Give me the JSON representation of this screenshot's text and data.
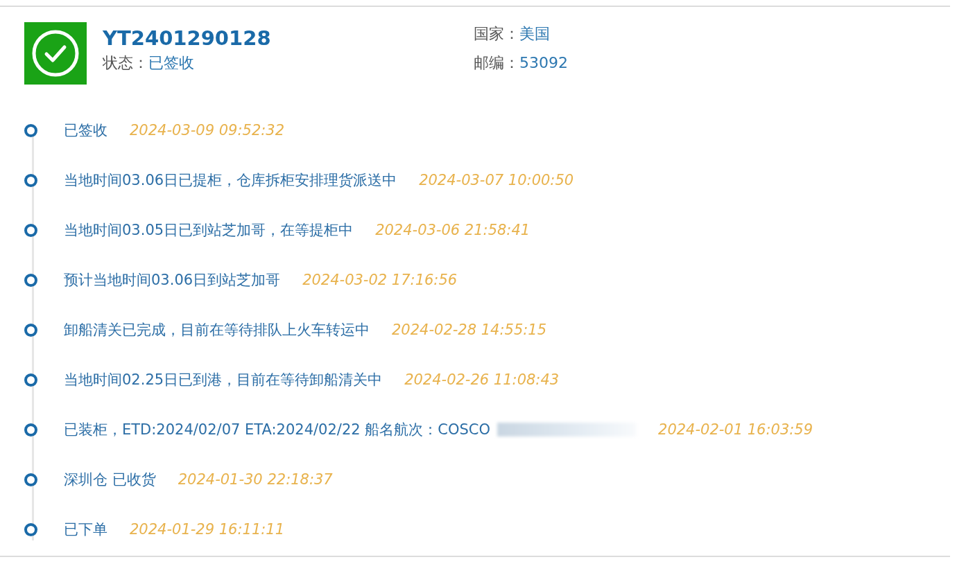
{
  "shipment": {
    "tracking_number": "YT2401290128",
    "status_label": "状态：",
    "status": "已签收",
    "delivered": true,
    "country_label": "国家：",
    "country": "美国",
    "postcode_label": "邮编：",
    "postcode": "53092"
  },
  "timeline": [
    {
      "text": "已签收",
      "time": "2024-03-09 09:52:32"
    },
    {
      "text": "当地时间03.06日已提柜，仓库拆柜安排理货派送中",
      "time": "2024-03-07 10:00:50"
    },
    {
      "text": "当地时间03.05日已到站芝加哥，在等提柜中",
      "time": "2024-03-06 21:58:41"
    },
    {
      "text": "预计当地时间03.06日到站芝加哥",
      "time": "2024-03-02 17:16:56"
    },
    {
      "text": "卸船清关已完成，目前在等待排队上火车转运中",
      "time": "2024-02-28 14:55:15"
    },
    {
      "text": "当地时间02.25日已到港，目前在等待卸船清关中",
      "time": "2024-02-26 11:08:43"
    },
    {
      "text": "已装柜，ETD:2024/02/07 ETA:2024/02/22 船名航次：COSCO",
      "time": "2024-02-01 16:03:59",
      "redacted": true
    },
    {
      "text": "深圳仓 已收货",
      "time": "2024-01-30 22:18:37"
    },
    {
      "text": "已下单",
      "time": "2024-01-29 16:11:11"
    }
  ]
}
